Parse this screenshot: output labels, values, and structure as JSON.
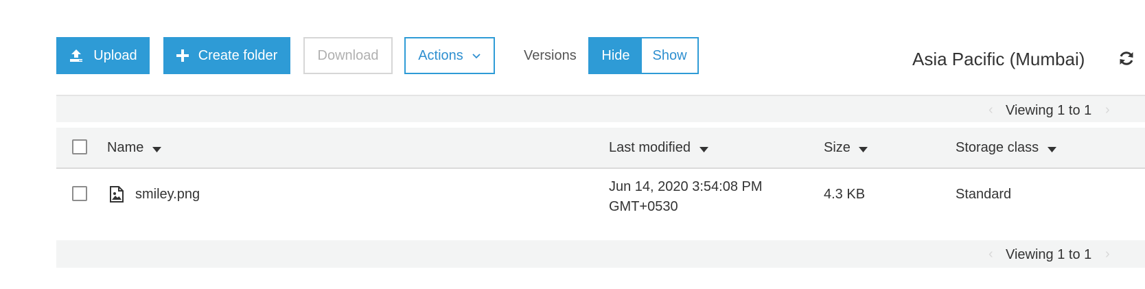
{
  "toolbar": {
    "upload_label": "Upload",
    "create_folder_label": "Create folder",
    "download_label": "Download",
    "actions_label": "Actions",
    "versions_label": "Versions",
    "versions_hide_label": "Hide",
    "versions_show_label": "Show",
    "versions_selected": "Hide",
    "region": "Asia Pacific (Mumbai)"
  },
  "pager": {
    "top_text": "Viewing 1 to 1",
    "bottom_text": "Viewing 1 to 1",
    "prev_symbol": "‹",
    "next_symbol": "›"
  },
  "table": {
    "columns": [
      "Name",
      "Last modified",
      "Size",
      "Storage class"
    ],
    "rows": [
      {
        "name": "smiley.png",
        "last_modified_line1": "Jun 14, 2020 3:54:08 PM",
        "last_modified_line2": "GMT+0530",
        "size": "4.3 KB",
        "storage_class": "Standard",
        "icon": "image-file-icon"
      }
    ]
  },
  "colors": {
    "primary": "#2e9bd6",
    "link": "#2e8fd0",
    "bar_background": "#f3f4f4",
    "text": "#333333",
    "disabled": "#b0b0b0"
  },
  "icons": [
    "upload-icon",
    "plus-icon",
    "chevron-down-icon",
    "refresh-icon",
    "sort-caret-icon",
    "image-file-icon"
  ]
}
